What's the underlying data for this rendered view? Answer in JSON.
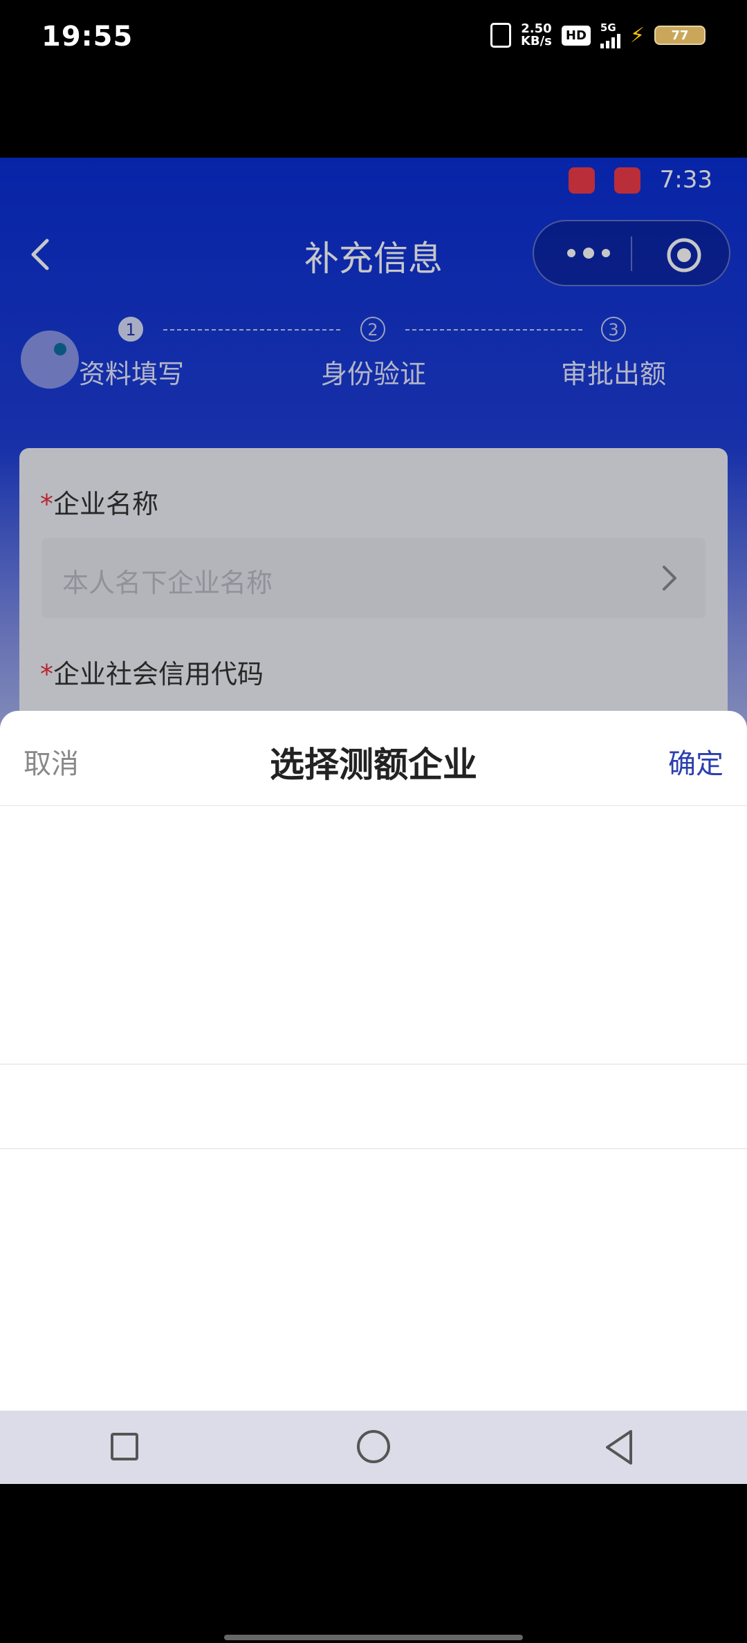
{
  "outer_status": {
    "time": "19:55",
    "net_speed_value": "2.50",
    "net_speed_unit": "KB/s",
    "hd_label": "HD",
    "network_label": "5G",
    "battery_level": "77"
  },
  "inner_status": {
    "time": "7:33"
  },
  "nav": {
    "title": "补充信息"
  },
  "steps": [
    {
      "num": "1",
      "label": "资料填写"
    },
    {
      "num": "2",
      "label": "身份验证"
    },
    {
      "num": "3",
      "label": "审批出额"
    }
  ],
  "form": {
    "company_name_label": "企业名称",
    "company_name_placeholder": "本人名下企业名称",
    "credit_code_label": "企业社会信用代码",
    "required_mark": "*"
  },
  "sheet": {
    "cancel_label": "取消",
    "title": "选择测额企业",
    "confirm_label": "确定"
  },
  "colors": {
    "primary_blue": "#0a2fd6",
    "confirm_blue": "#2a3fb0",
    "required_red": "#e8303a"
  }
}
